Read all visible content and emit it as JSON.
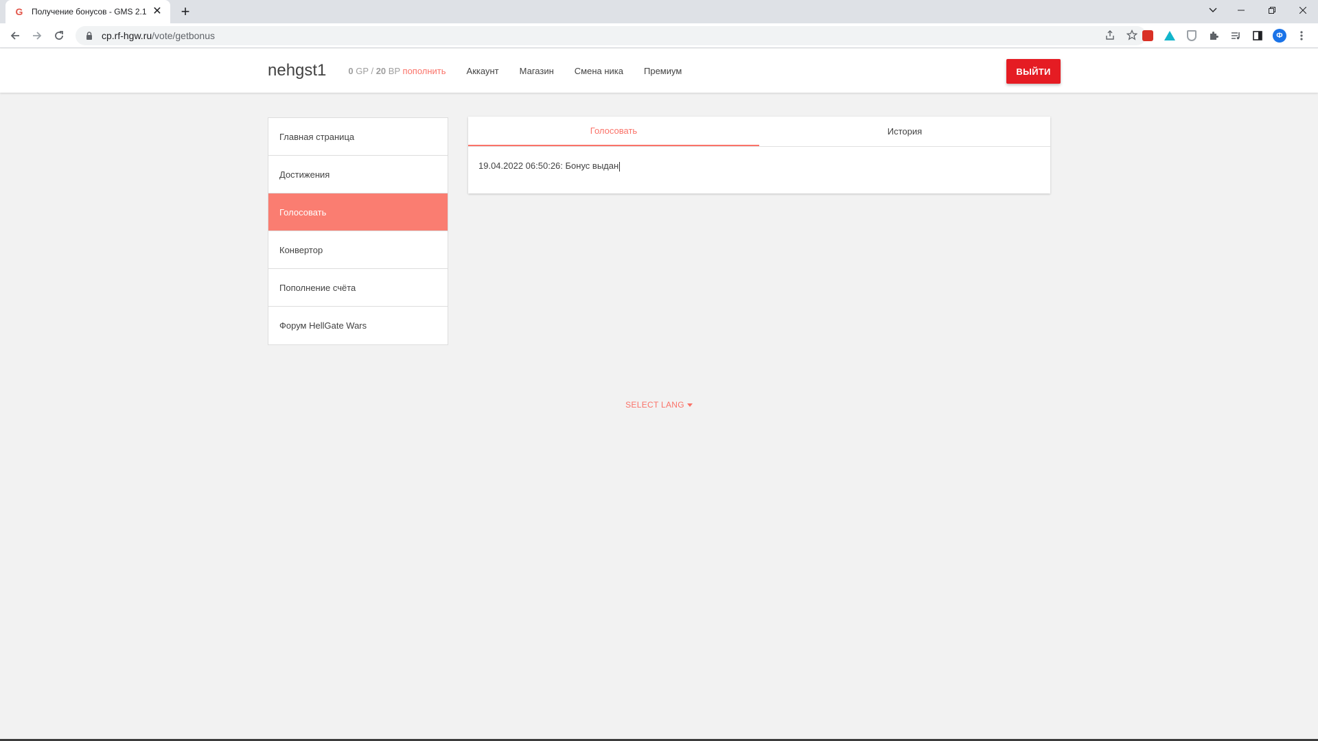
{
  "browser": {
    "tab_title": "Получение бонусов - GMS 2.1",
    "favicon_letter": "G",
    "url_host": "cp.rf-hgw.ru",
    "url_path": "/vote/getbonus",
    "profile_letter": "Ф"
  },
  "header": {
    "username": "nehgst1",
    "gp_value": "0",
    "gp_unit": "GP",
    "separator": "/",
    "bp_value": "20",
    "bp_unit": "BP",
    "topup_label": "пополнить",
    "nav": [
      "Аккаунт",
      "Магазин",
      "Смена ника",
      "Премиум"
    ],
    "logout_label": "ВЫЙТИ"
  },
  "sidebar": {
    "items": [
      "Главная страница",
      "Достижения",
      "Голосовать",
      "Конвертор",
      "Пополнение счёта",
      "Форум HellGate Wars"
    ],
    "active_index": 2
  },
  "card": {
    "tabs": [
      "Голосовать",
      "История"
    ],
    "active_tab": 0,
    "message": "19.04.2022 06:50:26: Бонус выдан"
  },
  "footer": {
    "lang_label": "SELECT LANG"
  },
  "colors": {
    "accent": "#fa7268",
    "sidebar_active": "#fa7d71",
    "logout": "#e51c23"
  }
}
